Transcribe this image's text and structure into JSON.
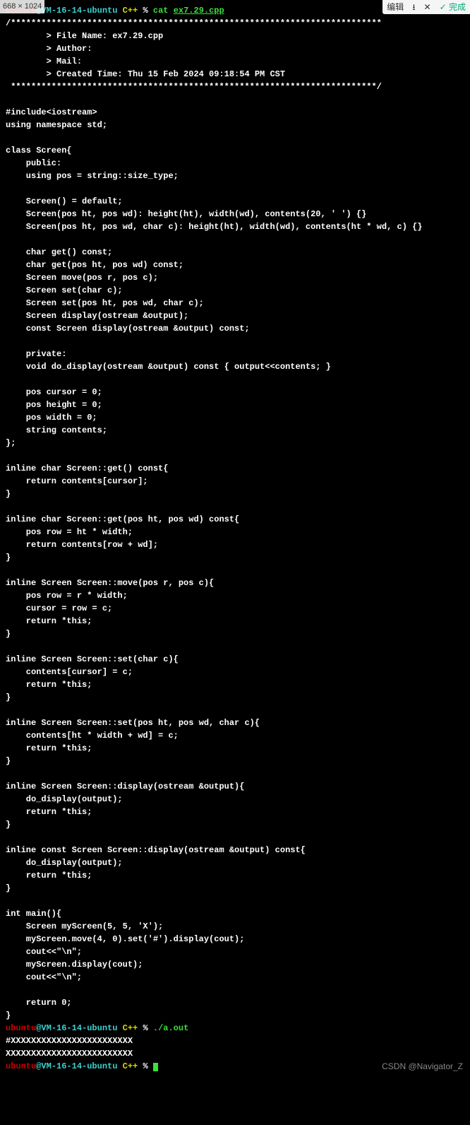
{
  "dim_label": "668 × 1024",
  "toolbar": {
    "edit": "编辑",
    "download": "⭳",
    "close": "✕",
    "done_check": "✓",
    "done_label": "完成"
  },
  "prompt": {
    "user": "ubuntu",
    "at": "@",
    "host": "VM-16-14-ubuntu",
    "lang": "C++",
    "pct": "%",
    "cat_cmd": "cat",
    "cat_arg": "ex7.29.cpp",
    "run_cmd": "./a.out"
  },
  "code": [
    "/*************************************************************************",
    "        > File Name: ex7.29.cpp",
    "        > Author:",
    "        > Mail:",
    "        > Created Time: Thu 15 Feb 2024 09:18:54 PM CST",
    " ************************************************************************/",
    "",
    "#include<iostream>",
    "using namespace std;",
    "",
    "class Screen{",
    "    public:",
    "    using pos = string::size_type;",
    "",
    "    Screen() = default;",
    "    Screen(pos ht, pos wd): height(ht), width(wd), contents(20, ' ') {}",
    "    Screen(pos ht, pos wd, char c): height(ht), width(wd), contents(ht * wd, c) {}",
    "",
    "    char get() const;",
    "    char get(pos ht, pos wd) const;",
    "    Screen move(pos r, pos c);",
    "    Screen set(char c);",
    "    Screen set(pos ht, pos wd, char c);",
    "    Screen display(ostream &output);",
    "    const Screen display(ostream &output) const;",
    "",
    "    private:",
    "    void do_display(ostream &output) const { output<<contents; }",
    "",
    "    pos cursor = 0;",
    "    pos height = 0;",
    "    pos width = 0;",
    "    string contents;",
    "};",
    "",
    "inline char Screen::get() const{",
    "    return contents[cursor];",
    "}",
    "",
    "inline char Screen::get(pos ht, pos wd) const{",
    "    pos row = ht * width;",
    "    return contents[row + wd];",
    "}",
    "",
    "inline Screen Screen::move(pos r, pos c){",
    "    pos row = r * width;",
    "    cursor = row = c;",
    "    return *this;",
    "}",
    "",
    "inline Screen Screen::set(char c){",
    "    contents[cursor] = c;",
    "    return *this;",
    "}",
    "",
    "inline Screen Screen::set(pos ht, pos wd, char c){",
    "    contents[ht * width + wd] = c;",
    "    return *this;",
    "}",
    "",
    "inline Screen Screen::display(ostream &output){",
    "    do_display(output);",
    "    return *this;",
    "}",
    "",
    "inline const Screen Screen::display(ostream &output) const{",
    "    do_display(output);",
    "    return *this;",
    "}",
    "",
    "int main(){",
    "    Screen myScreen(5, 5, 'X');",
    "    myScreen.move(4, 0).set('#').display(cout);",
    "    cout<<\"\\n\";",
    "    myScreen.display(cout);",
    "    cout<<\"\\n\";",
    "",
    "    return 0;",
    "}"
  ],
  "output": [
    "#XXXXXXXXXXXXXXXXXXXXXXXX",
    "XXXXXXXXXXXXXXXXXXXXXXXXX"
  ],
  "watermark": "CSDN @Navigator_Z"
}
